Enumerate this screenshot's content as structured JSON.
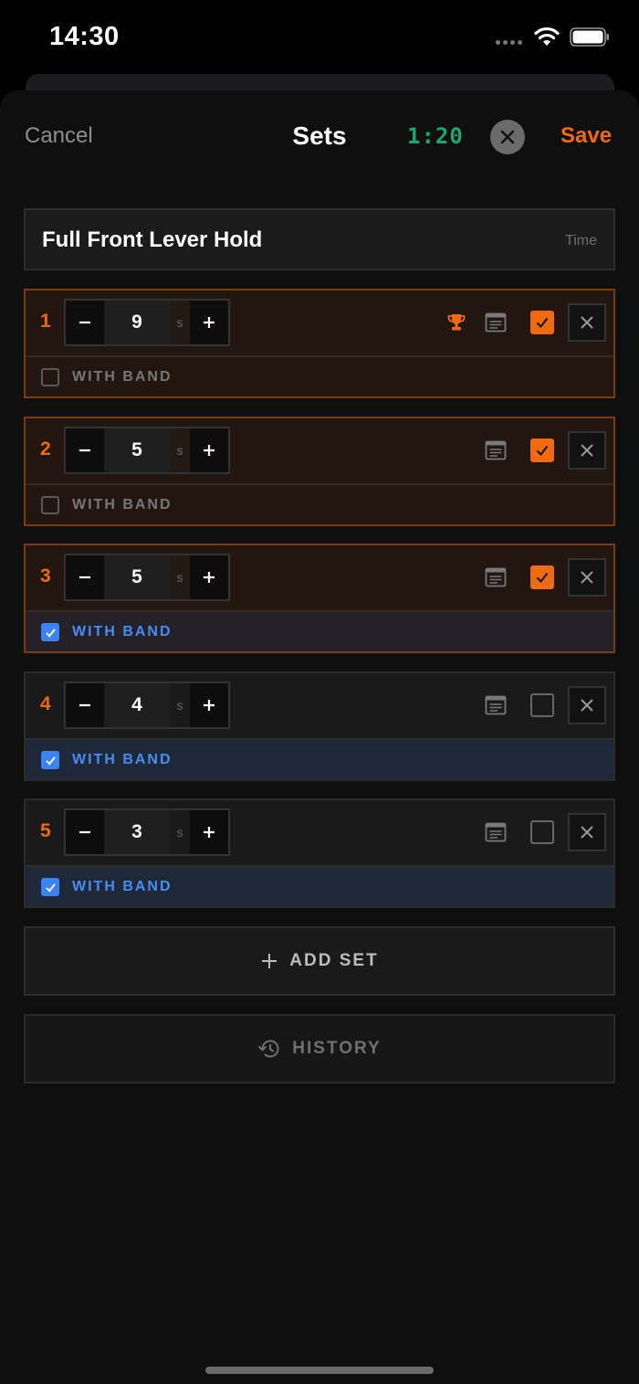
{
  "status_bar": {
    "time": "14:30"
  },
  "nav": {
    "cancel_label": "Cancel",
    "title": "Sets",
    "timer": "1:20",
    "save_label": "Save"
  },
  "exercise": {
    "name": "Full Front Lever Hold",
    "type": "Time"
  },
  "sets": [
    {
      "number": "1",
      "value": "9",
      "unit": "s",
      "completed": true,
      "record": true,
      "band": true,
      "band_checked": false,
      "band_label": "WITH BAND"
    },
    {
      "number": "2",
      "value": "5",
      "unit": "s",
      "completed": true,
      "record": false,
      "band_checked": false,
      "band_label": "WITH BAND"
    },
    {
      "number": "3",
      "value": "5",
      "unit": "s",
      "completed": true,
      "record": false,
      "band_checked": true,
      "band_label": "WITH BAND"
    },
    {
      "number": "4",
      "value": "4",
      "unit": "s",
      "completed": false,
      "record": false,
      "band_checked": true,
      "band_label": "WITH BAND"
    },
    {
      "number": "5",
      "value": "3",
      "unit": "s",
      "completed": false,
      "record": false,
      "band_checked": true,
      "band_label": "WITH BAND"
    }
  ],
  "add_set_label": "ADD SET",
  "history_label": "HISTORY",
  "colors": {
    "accent_orange": "#f06a10",
    "band_blue": "#3b82f6",
    "timer_green": "#1ea672"
  }
}
